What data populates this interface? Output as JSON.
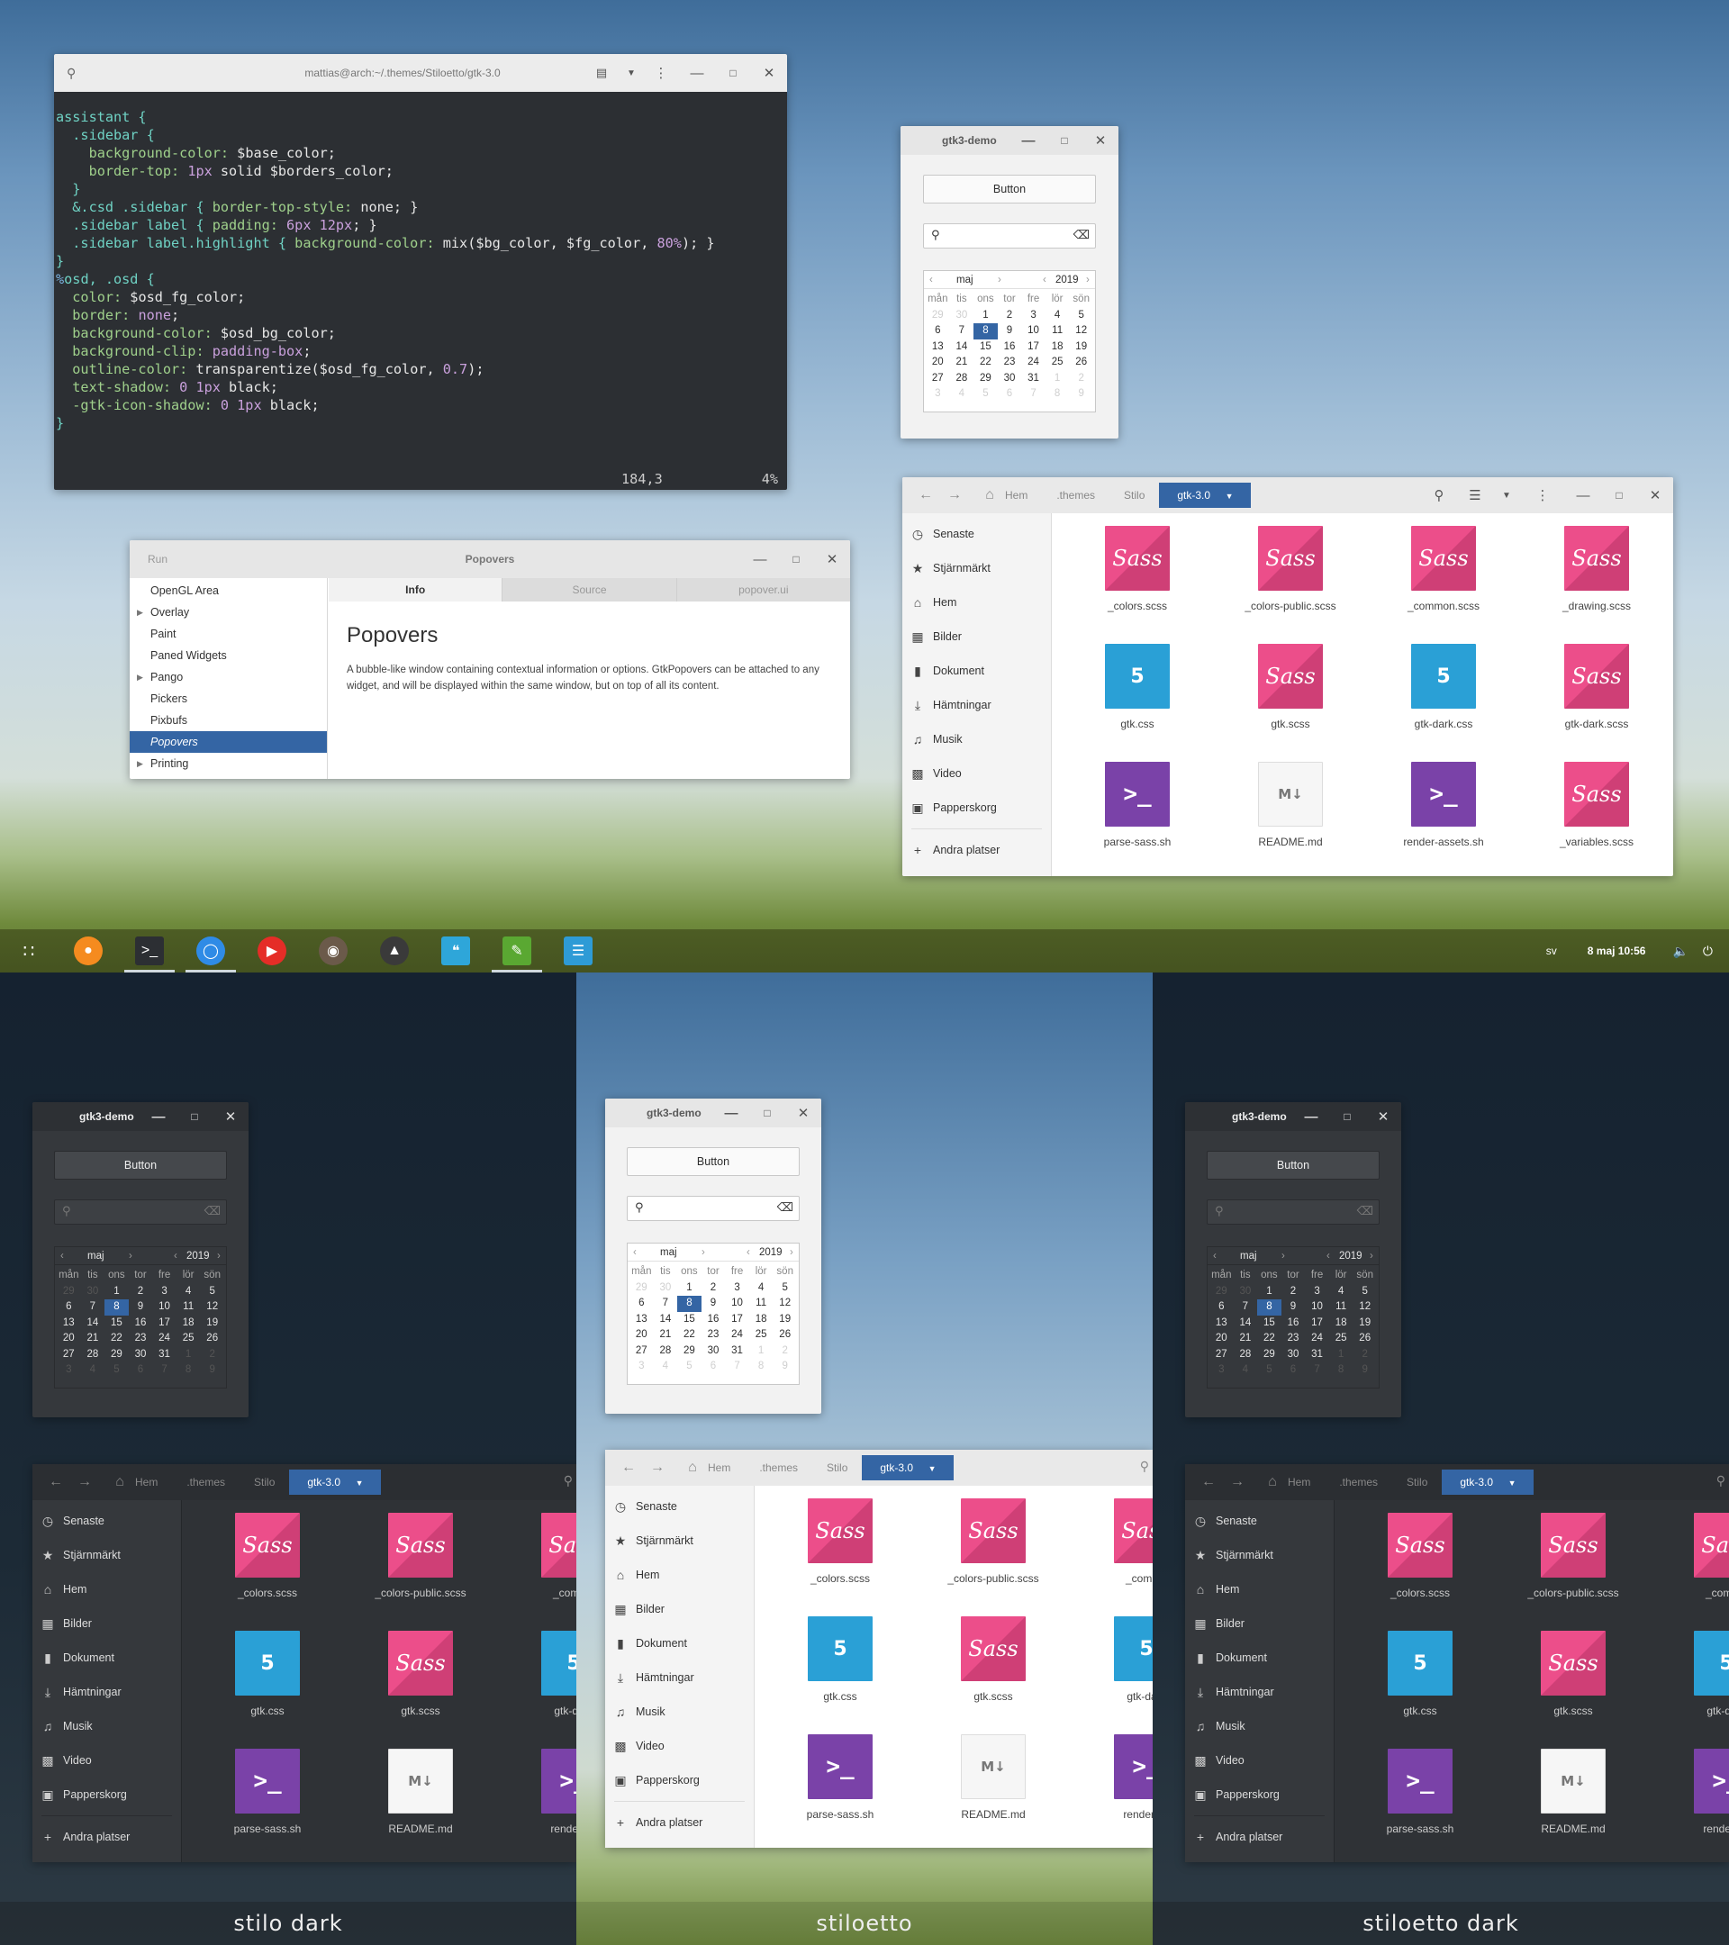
{
  "terminal": {
    "title": "mattias@arch:~/.themes/Stiloetto/gtk-3.0",
    "status_pos": "184,3",
    "status_pct": "4%"
  },
  "popovers": {
    "run_label": "Run",
    "title": "Popovers",
    "items": [
      {
        "label": "OpenGL Area",
        "expander": false
      },
      {
        "label": "Overlay",
        "expander": true
      },
      {
        "label": "Paint",
        "expander": false
      },
      {
        "label": "Paned Widgets",
        "expander": false
      },
      {
        "label": "Pango",
        "expander": true
      },
      {
        "label": "Pickers",
        "expander": false
      },
      {
        "label": "Pixbufs",
        "expander": false
      },
      {
        "label": "Popovers",
        "expander": false,
        "selected": true
      },
      {
        "label": "Printing",
        "expander": true
      }
    ],
    "tabs": [
      "Info",
      "Source",
      "popover.ui"
    ],
    "heading": "Popovers",
    "body": "A bubble-like window containing contextual information or options. GtkPopovers can be attached to any widget, and will be displayed within the same window, but on top of all its content."
  },
  "demo": {
    "title": "gtk3-demo",
    "button_label": "Button",
    "month": "maj",
    "year": "2019",
    "day_names": [
      "mån",
      "tis",
      "ons",
      "tor",
      "fre",
      "lör",
      "sön"
    ],
    "prev_days": [
      "29",
      "30"
    ],
    "days": [
      "1",
      "2",
      "3",
      "4",
      "5",
      "6",
      "7",
      "8",
      "9",
      "10",
      "11",
      "12",
      "13",
      "14",
      "15",
      "16",
      "17",
      "18",
      "19",
      "20",
      "21",
      "22",
      "23",
      "24",
      "25",
      "26",
      "27",
      "28",
      "29",
      "30",
      "31"
    ],
    "next_days": [
      "1",
      "2",
      "3",
      "4",
      "5",
      "6",
      "7",
      "8",
      "9"
    ],
    "selected_day": "8"
  },
  "files": {
    "breadcrumbs": [
      "Hem",
      ".themes",
      "Stilo",
      "gtk-3.0"
    ],
    "sidebar": [
      "Senaste",
      "Stjärnmärkt",
      "Hem",
      "Bilder",
      "Dokument",
      "Hämtningar",
      "Musik",
      "Video",
      "Papperskorg"
    ],
    "other_places": "Andra platser",
    "items": [
      {
        "name": "_colors.scss",
        "type": "sass"
      },
      {
        "name": "_colors-public.scss",
        "type": "sass"
      },
      {
        "name": "_common.scss",
        "type": "sass"
      },
      {
        "name": "_drawing.scss",
        "type": "sass"
      },
      {
        "name": "gtk.css",
        "type": "css"
      },
      {
        "name": "gtk.scss",
        "type": "sass"
      },
      {
        "name": "gtk-dark.css",
        "type": "css"
      },
      {
        "name": "gtk-dark.scss",
        "type": "sass"
      },
      {
        "name": "parse-sass.sh",
        "type": "term"
      },
      {
        "name": "README.md",
        "type": "md"
      },
      {
        "name": "render-assets.sh",
        "type": "term"
      },
      {
        "name": "_variables.scss",
        "type": "sass"
      }
    ],
    "cut_labels": {
      "_common.scss": "_commo",
      "gtk-dark.css": "gtk-dark",
      "render-assets.sh": "render-as"
    }
  },
  "taskbar": {
    "apps": [
      "launcher-grid",
      "firefox",
      "terminal",
      "browser",
      "youtube",
      "gimp",
      "inkscape",
      "quote-app",
      "gedit",
      "settings"
    ],
    "lang": "sv",
    "datetime": "8 maj 10:56"
  },
  "captions": {
    "left": "stilo dark",
    "middle": "stiloetto",
    "right": "stiloetto dark"
  },
  "colors": {
    "accent": "#3465a4",
    "sass": "#ec4e8a",
    "css": "#2aa0d6",
    "terminal_icon": "#7a42a8"
  }
}
